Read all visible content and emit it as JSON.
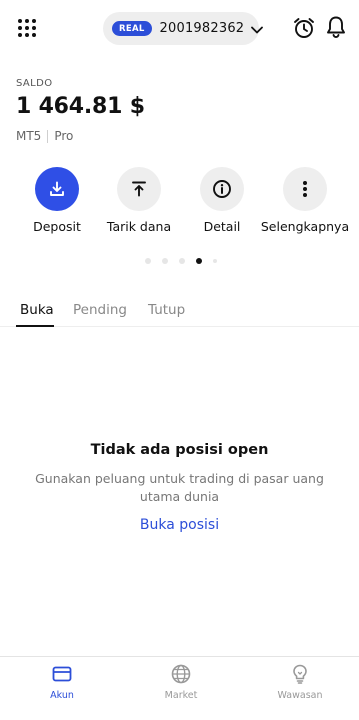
{
  "header": {
    "account_badge": "REAL",
    "account_number": "2001982362",
    "icons": [
      "grid-menu-icon",
      "chevron-down-icon",
      "alarm-clock-icon",
      "bell-icon"
    ]
  },
  "balance": {
    "label": "SALDO",
    "amount": "1 464.81 $",
    "platform": "MT5",
    "account_type": "Pro"
  },
  "actions": [
    {
      "label": "Deposit",
      "icon": "download-icon",
      "color": "#2f4fe6"
    },
    {
      "label": "Tarik dana",
      "icon": "upload-icon"
    },
    {
      "label": "Detail",
      "icon": "info-icon"
    },
    {
      "label": "Selengkapnya",
      "icon": "more-vertical-icon"
    }
  ],
  "tabs": [
    {
      "label": "Buka",
      "active": true
    },
    {
      "label": "Pending",
      "active": false
    },
    {
      "label": "Tutup",
      "active": false
    }
  ],
  "empty_state": {
    "title": "Tidak ada posisi open",
    "description": "Gunakan peluang untuk trading di pasar uang utama dunia",
    "link": "Buka posisi"
  },
  "bottom_nav": [
    {
      "label": "Akun",
      "icon": "card-icon",
      "active": true
    },
    {
      "label": "Market",
      "icon": "globe-icon",
      "active": false
    },
    {
      "label": "Wawasan",
      "icon": "lightbulb-icon",
      "active": false
    }
  ],
  "colors": {
    "accent": "#2c4ed8",
    "primary_button": "#2f4fe6"
  }
}
